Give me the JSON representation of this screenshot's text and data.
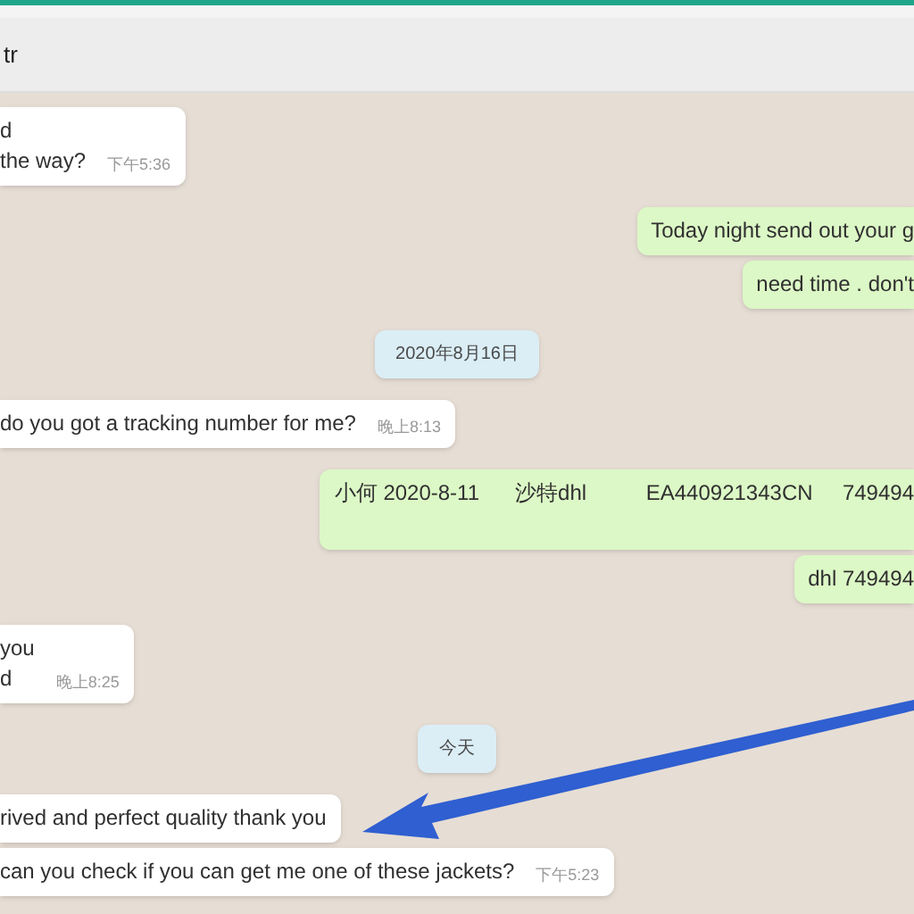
{
  "header": {
    "title": "tr"
  },
  "messages": [
    {
      "kind": "in",
      "lines": [
        "d",
        "the way?"
      ],
      "time": "下午5:36"
    },
    {
      "kind": "out",
      "lines": [
        "Today night send out your g"
      ]
    },
    {
      "kind": "out",
      "lines": [
        "need time . don't"
      ]
    },
    {
      "kind": "date",
      "lines": [
        "2020年8月16日"
      ]
    },
    {
      "kind": "in",
      "lines": [
        "do you got a tracking number for me?"
      ],
      "time": "晚上8:13"
    },
    {
      "kind": "out",
      "lines": [
        "小何 2020-8-11      沙特dhl          EA440921343CN     749494"
      ],
      "tall": true
    },
    {
      "kind": "out",
      "lines": [
        "dhl 749494"
      ]
    },
    {
      "kind": "in",
      "lines": [
        "you",
        "d"
      ],
      "time": "晚上8:25"
    },
    {
      "kind": "date",
      "lines": [
        "今天"
      ]
    },
    {
      "kind": "in",
      "lines": [
        "rived and perfect quality thank you"
      ]
    },
    {
      "kind": "in",
      "lines": [
        "can you check if you can get me one of these jackets?"
      ],
      "time": "下午5:23"
    }
  ]
}
